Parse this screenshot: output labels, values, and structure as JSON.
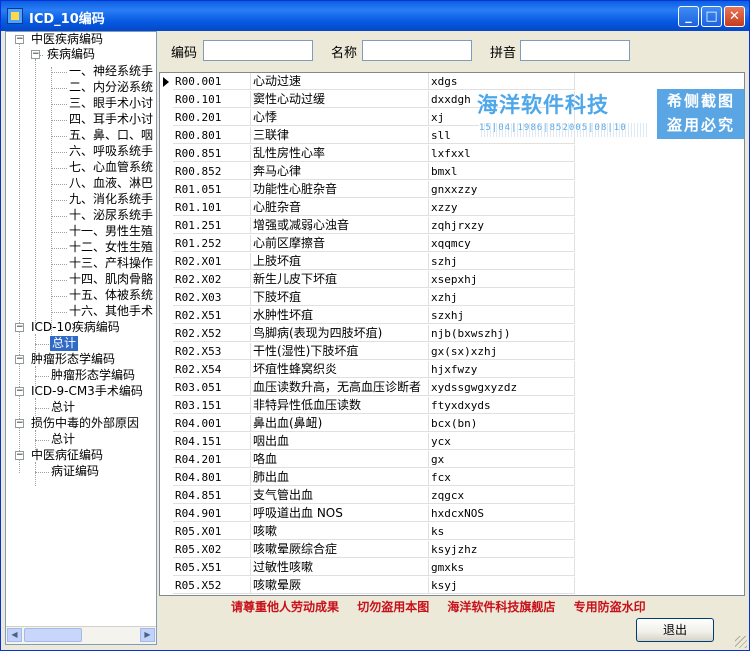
{
  "window": {
    "title": "ICD_10编码",
    "min_label": "_",
    "max_label": "□",
    "close_label": "✕"
  },
  "tree": {
    "nodes": [
      {
        "label": "中医疾病编码",
        "pm": "−"
      },
      {
        "label": "疾病编码",
        "pm": "−"
      },
      {
        "label": "一、神经系统手"
      },
      {
        "label": "二、内分泌系统"
      },
      {
        "label": "三、眼手术小讨"
      },
      {
        "label": "四、耳手术小讨"
      },
      {
        "label": "五、鼻、口、咽"
      },
      {
        "label": "六、呼吸系统手"
      },
      {
        "label": "七、心血管系统"
      },
      {
        "label": "八、血液、淋巴"
      },
      {
        "label": "九、消化系统手"
      },
      {
        "label": "十、泌尿系统手"
      },
      {
        "label": "十一、男性生殖"
      },
      {
        "label": "十二、女性生殖"
      },
      {
        "label": "十三、产科操作"
      },
      {
        "label": "十四、肌肉骨骼"
      },
      {
        "label": "十五、体被系统"
      },
      {
        "label": "十六、其他手术"
      },
      {
        "label": "ICD-10疾病编码",
        "pm": "−"
      },
      {
        "label": "总计",
        "selected": true
      },
      {
        "label": "肿瘤形态学编码",
        "pm": "−"
      },
      {
        "label": "肿瘤形态学编码"
      },
      {
        "label": "ICD-9-CM3手术编码",
        "pm": "−"
      },
      {
        "label": "总计"
      },
      {
        "label": "损伤中毒的外部原因",
        "pm": "−"
      },
      {
        "label": "总计"
      },
      {
        "label": "中医病征编码",
        "pm": "−"
      },
      {
        "label": "病证编码"
      }
    ],
    "scroll_left": "◀",
    "scroll_right": "▶"
  },
  "search": {
    "code_label": "编码",
    "code_value": "",
    "name_label": "名称",
    "name_value": "",
    "pinyin_label": "拼音",
    "pinyin_value": ""
  },
  "grid": {
    "rows": [
      {
        "code": "R00.001",
        "name": "心动过速",
        "py": "xdgs"
      },
      {
        "code": "R00.101",
        "name": "窦性心动过缓",
        "py": "dxxdgh"
      },
      {
        "code": "R00.201",
        "name": "心悸",
        "py": "xj"
      },
      {
        "code": "R00.801",
        "name": "三联律",
        "py": "sll"
      },
      {
        "code": "R00.851",
        "name": "乱性房性心率",
        "py": "lxfxxl"
      },
      {
        "code": "R00.852",
        "name": "奔马心律",
        "py": "bmxl"
      },
      {
        "code": "R01.051",
        "name": "功能性心脏杂音",
        "py": "gnxxzzy"
      },
      {
        "code": "R01.101",
        "name": "心脏杂音",
        "py": "xzzy"
      },
      {
        "code": "R01.251",
        "name": "增强或减弱心浊音",
        "py": "zqhjrxzy"
      },
      {
        "code": "R01.252",
        "name": "心前区摩擦音",
        "py": "xqqmcy"
      },
      {
        "code": "R02.X01",
        "name": "上肢坏疽",
        "py": "szhj"
      },
      {
        "code": "R02.X02",
        "name": "新生儿皮下坏疽",
        "py": "xsepxhj"
      },
      {
        "code": "R02.X03",
        "name": "下肢坏疽",
        "py": "xzhj"
      },
      {
        "code": "R02.X51",
        "name": "水肿性坏疽",
        "py": "szxhj"
      },
      {
        "code": "R02.X52",
        "name": "鸟脚病(表现为四肢坏疽)",
        "py": "njb(bxwszhj)"
      },
      {
        "code": "R02.X53",
        "name": "干性(湿性)下肢坏疽",
        "py": "gx(sx)xzhj"
      },
      {
        "code": "R02.X54",
        "name": "坏疽性蜂窝织炎",
        "py": "hjxfwzy"
      },
      {
        "code": "R03.051",
        "name": "血压读数升高，无高血压诊断者",
        "py": "xydssgwgxyzdz"
      },
      {
        "code": "R03.151",
        "name": "非特异性低血压读数",
        "py": "ftyxdxyds"
      },
      {
        "code": "R04.001",
        "name": "鼻出血(鼻衄)",
        "py": "bcx(bn)"
      },
      {
        "code": "R04.151",
        "name": "咽出血",
        "py": "ycx"
      },
      {
        "code": "R04.201",
        "name": "咯血",
        "py": "gx"
      },
      {
        "code": "R04.801",
        "name": "肺出血",
        "py": "fcx"
      },
      {
        "code": "R04.851",
        "name": "支气管出血",
        "py": "zqgcx"
      },
      {
        "code": "R04.901",
        "name": "呼吸道出血 NOS",
        "py": "hxdcxNOS"
      },
      {
        "code": "R05.X01",
        "name": "咳嗽",
        "py": "ks"
      },
      {
        "code": "R05.X02",
        "name": "咳嗽晕厥综合症",
        "py": "ksyjzhz"
      },
      {
        "code": "R05.X51",
        "name": "过敏性咳嗽",
        "py": "gmxks"
      },
      {
        "code": "R05.X52",
        "name": "咳嗽晕厥",
        "py": "ksyj"
      }
    ]
  },
  "watermark": {
    "title": "海洋软件科技",
    "code": "15|04|1986|852005|08|10",
    "box_line1": "希侧截图",
    "box_line2": "盗用必究"
  },
  "footer": {
    "notice_1": "请尊重他人劳动成果",
    "notice_2": "切勿盗用本图",
    "notice_3": "海洋软件科技旗舰店",
    "notice_4": "专用防盗水印"
  },
  "buttons": {
    "exit_label": "退出"
  }
}
